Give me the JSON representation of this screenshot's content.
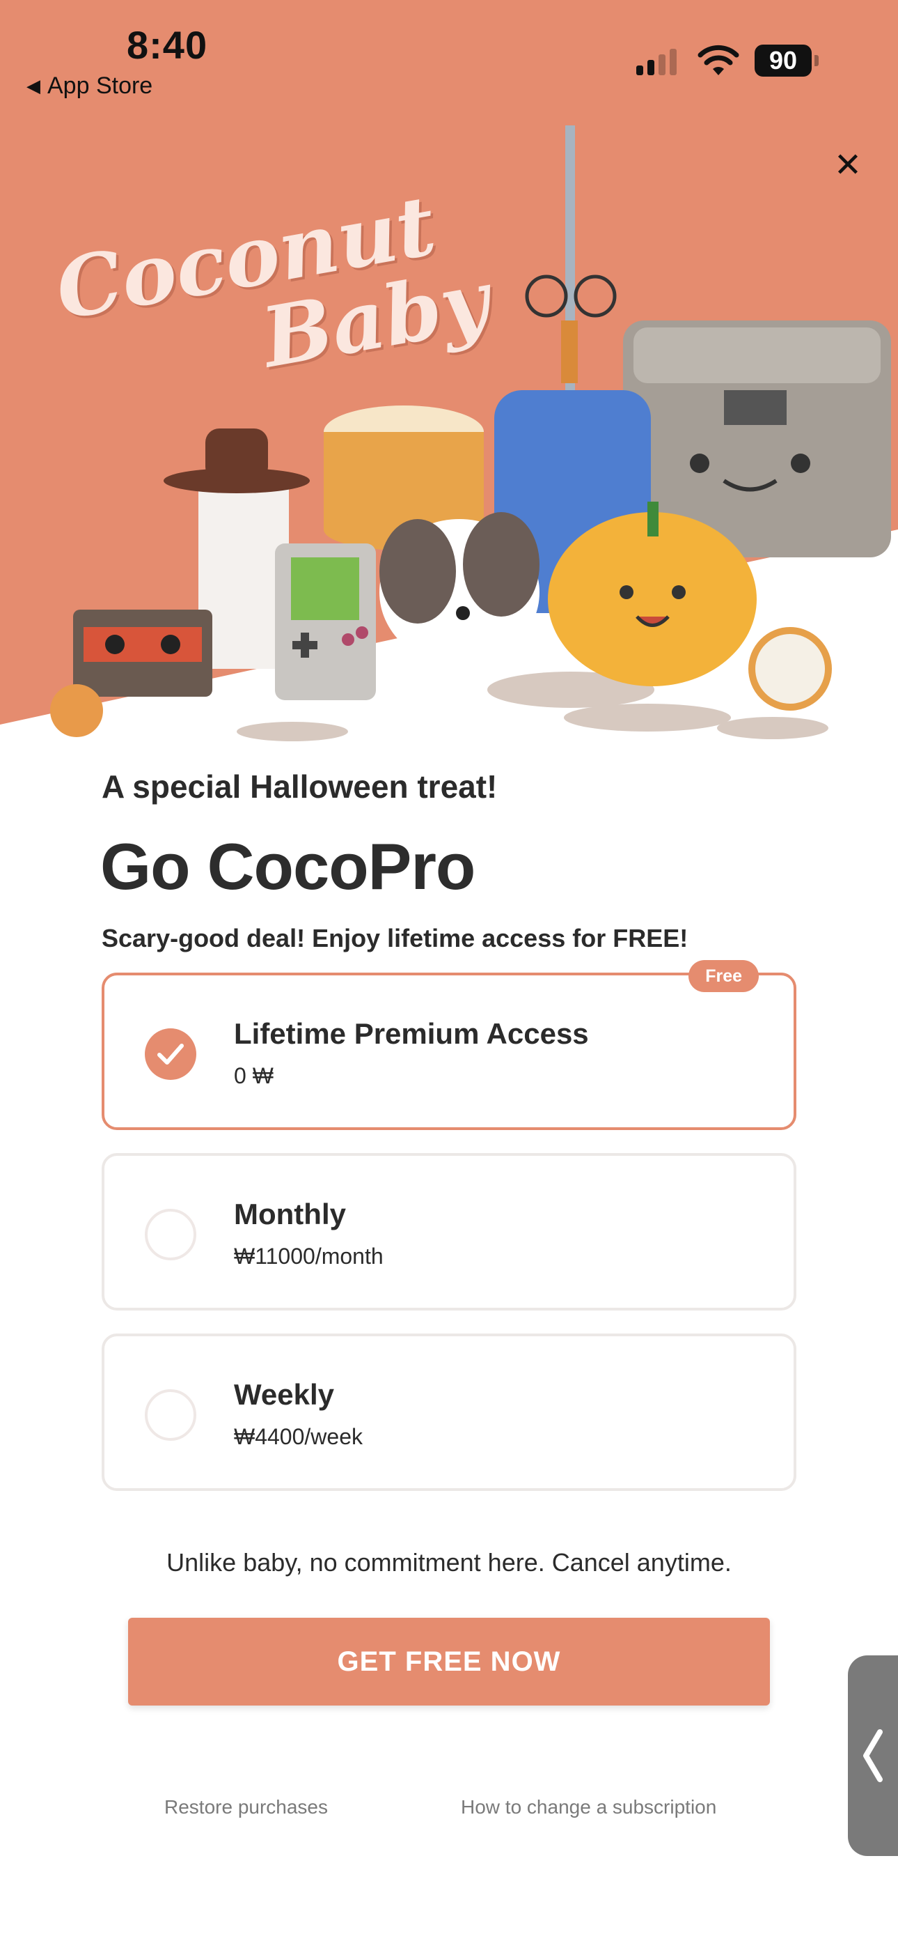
{
  "status_bar": {
    "time": "8:40",
    "back_label": "App Store",
    "battery": "90"
  },
  "hero": {
    "logo_line1": "Coconut",
    "logo_line2": "Baby",
    "background_color": "#e58c6f"
  },
  "paywall": {
    "kicker": "A special Halloween treat!",
    "title": "Go CocoPro",
    "subtitle": "Scary-good deal! Enjoy lifetime access for FREE!",
    "plans": [
      {
        "name": "Lifetime Premium Access",
        "price": "0 ₩",
        "badge": "Free",
        "selected": true
      },
      {
        "name": "Monthly",
        "price": "₩11000/month",
        "selected": false
      },
      {
        "name": "Weekly",
        "price": "₩4400/week",
        "selected": false
      }
    ],
    "note": "Unlike baby, no commitment here. Cancel anytime.",
    "cta_label": "GET FREE NOW",
    "restore_label": "Restore purchases",
    "how_to_label": "How to change a subscription"
  },
  "colors": {
    "accent": "#e58c6f",
    "text": "#2b2b2b",
    "muted": "#7a7a7a"
  },
  "icons": {
    "close": "close-icon",
    "check": "checkmark-icon",
    "back": "back-triangle-icon",
    "handle": "chevron-left-icon"
  }
}
